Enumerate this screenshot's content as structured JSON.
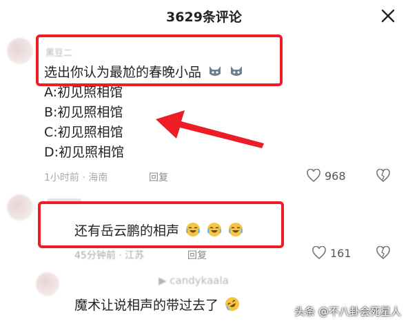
{
  "header": {
    "title": "3629条评论",
    "close_icon": "close-icon"
  },
  "comments": [
    {
      "username": "黑豆二",
      "text": "选出你认为最尬的春晚小品",
      "options": [
        "A:初见照相馆",
        "B:初见照相馆",
        "C:初见照相馆",
        "D:初见照相馆"
      ],
      "meta": "1小时前 · 海南",
      "reply_label": "回复",
      "likes": "968"
    },
    {
      "username": "",
      "text": "还有岳云鹏的相声",
      "meta": "45分钟前 · 江苏",
      "reply_label": "回复",
      "likes": "161"
    },
    {
      "username": "▶ candykaala",
      "text": "魔术让说相声的带过去了"
    }
  ],
  "watermark": "头条 @不八卦会死星人",
  "colors": {
    "highlight_box": "#ee1c25",
    "arrow": "#ee1c25"
  }
}
